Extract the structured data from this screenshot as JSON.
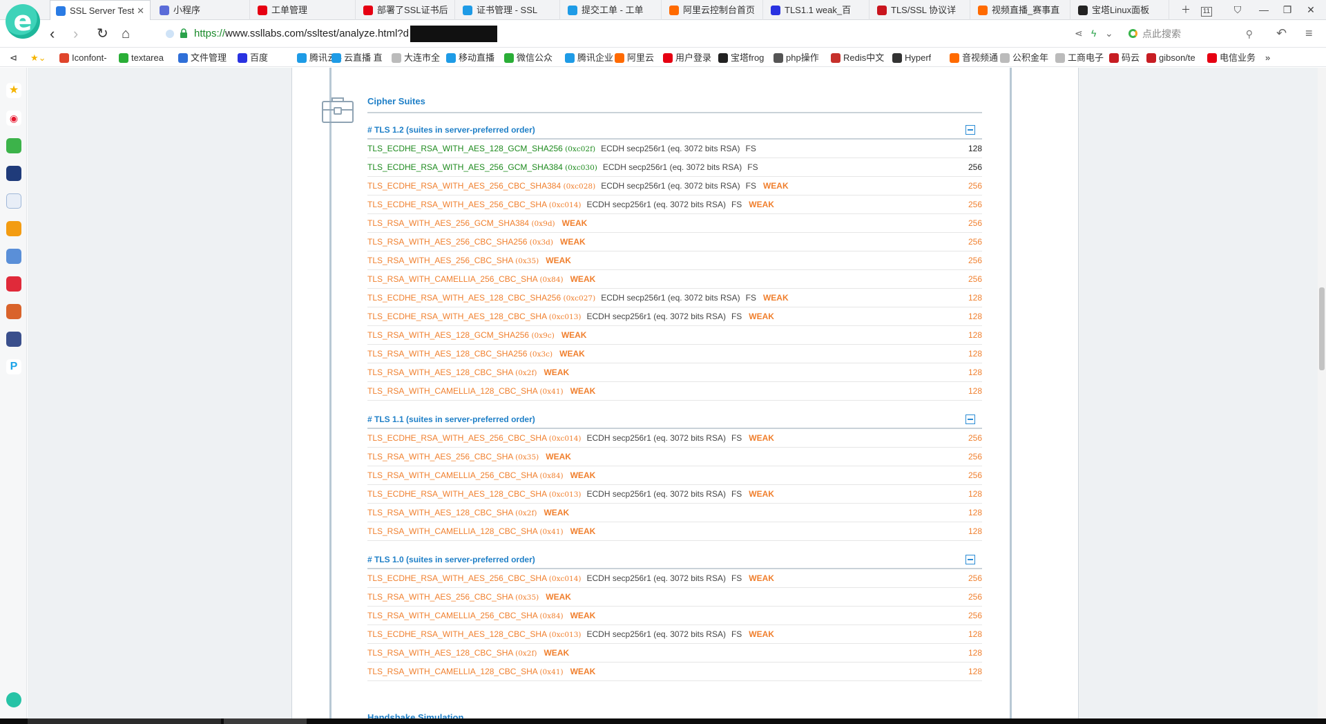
{
  "browser": {
    "tabs": [
      {
        "label": "SSL Server Test",
        "active": true,
        "color": "#2a7be4"
      },
      {
        "label": "小程序",
        "active": false,
        "color": "#5a6bd8"
      },
      {
        "label": "工单管理",
        "active": false,
        "color": "#e60012"
      },
      {
        "label": "部署了SSL证书后",
        "active": false,
        "color": "#e60012"
      },
      {
        "label": "证书管理 - SSL",
        "active": false,
        "color": "#1e9be6"
      },
      {
        "label": "提交工单 - 工单",
        "active": false,
        "color": "#1e9be6"
      },
      {
        "label": "阿里云控制台首页",
        "active": false,
        "color": "#ff6a00"
      },
      {
        "label": "TLS1.1 weak_百",
        "active": false,
        "color": "#2932e1"
      },
      {
        "label": "TLS/SSL 协议详",
        "active": false,
        "color": "#c9151e"
      },
      {
        "label": "视频直播_赛事直",
        "active": false,
        "color": "#ff6a00"
      },
      {
        "label": "宝塔Linux面板",
        "active": false,
        "color": "#222222"
      }
    ],
    "tab_count": "11",
    "url_scheme": "https://",
    "url_host": "www.ssllabs.com",
    "url_path": "/ssltest/analyze.html?d",
    "search_placeholder": "点此搜索",
    "bookmarks": [
      {
        "label": "Iconfont-",
        "color": "#e0452c"
      },
      {
        "label": "textarea",
        "color": "#2aae37"
      },
      {
        "label": "文件管理",
        "color": "#2f6fd8"
      },
      {
        "label": "百度",
        "color": "#2932e1"
      },
      {
        "label": "腾讯云 -",
        "color": "#1e9be6"
      },
      {
        "label": "云直播 直",
        "color": "#1e9be6"
      },
      {
        "label": "大连市全",
        "color": "#bbbbbb"
      },
      {
        "label": "移动直播",
        "color": "#1e9be6"
      },
      {
        "label": "微信公众",
        "color": "#2aae37"
      },
      {
        "label": "腾讯企业",
        "color": "#1e9be6"
      },
      {
        "label": "阿里云",
        "color": "#ff6a00"
      },
      {
        "label": "用户登录",
        "color": "#e60012"
      },
      {
        "label": "宝塔frog",
        "color": "#222222"
      },
      {
        "label": "php操作",
        "color": "#555555"
      },
      {
        "label": "Redis中文",
        "color": "#c6302b"
      },
      {
        "label": "Hyperf",
        "color": "#333333"
      },
      {
        "label": "音视频通",
        "color": "#ff6a00"
      },
      {
        "label": "公积金年",
        "color": "#bbbbbb"
      },
      {
        "label": "工商电子",
        "color": "#bbbbbb"
      },
      {
        "label": "码云",
        "color": "#c71d23"
      },
      {
        "label": "gibson/te",
        "color": "#c71d23"
      },
      {
        "label": "电信业务",
        "color": "#e60012"
      }
    ]
  },
  "section": {
    "title": "Cipher Suites",
    "next_title": "Handshake Simulation"
  },
  "groups": [
    {
      "heading": "# TLS 1.2 (suites in server-preferred order)",
      "rows": [
        {
          "name": "TLS_ECDHE_RSA_WITH_AES_128_GCM_SHA256",
          "hex": "(0xc02f)",
          "info": "ECDH secp256r1 (eq. 3072 bits RSA)",
          "fs": "FS",
          "weak": "",
          "bits": "128",
          "strong": true
        },
        {
          "name": "TLS_ECDHE_RSA_WITH_AES_256_GCM_SHA384",
          "hex": "(0xc030)",
          "info": "ECDH secp256r1 (eq. 3072 bits RSA)",
          "fs": "FS",
          "weak": "",
          "bits": "256",
          "strong": true
        },
        {
          "name": "TLS_ECDHE_RSA_WITH_AES_256_CBC_SHA384",
          "hex": "(0xc028)",
          "info": "ECDH secp256r1 (eq. 3072 bits RSA)",
          "fs": "FS",
          "weak": "WEAK",
          "bits": "256",
          "strong": false
        },
        {
          "name": "TLS_ECDHE_RSA_WITH_AES_256_CBC_SHA",
          "hex": "(0xc014)",
          "info": "ECDH secp256r1 (eq. 3072 bits RSA)",
          "fs": "FS",
          "weak": "WEAK",
          "bits": "256",
          "strong": false
        },
        {
          "name": "TLS_RSA_WITH_AES_256_GCM_SHA384",
          "hex": "(0x9d)",
          "info": "",
          "fs": "",
          "weak": "WEAK",
          "bits": "256",
          "strong": false
        },
        {
          "name": "TLS_RSA_WITH_AES_256_CBC_SHA256",
          "hex": "(0x3d)",
          "info": "",
          "fs": "",
          "weak": "WEAK",
          "bits": "256",
          "strong": false
        },
        {
          "name": "TLS_RSA_WITH_AES_256_CBC_SHA",
          "hex": "(0x35)",
          "info": "",
          "fs": "",
          "weak": "WEAK",
          "bits": "256",
          "strong": false
        },
        {
          "name": "TLS_RSA_WITH_CAMELLIA_256_CBC_SHA",
          "hex": "(0x84)",
          "info": "",
          "fs": "",
          "weak": "WEAK",
          "bits": "256",
          "strong": false
        },
        {
          "name": "TLS_ECDHE_RSA_WITH_AES_128_CBC_SHA256",
          "hex": "(0xc027)",
          "info": "ECDH secp256r1 (eq. 3072 bits RSA)",
          "fs": "FS",
          "weak": "WEAK",
          "bits": "128",
          "strong": false
        },
        {
          "name": "TLS_ECDHE_RSA_WITH_AES_128_CBC_SHA",
          "hex": "(0xc013)",
          "info": "ECDH secp256r1 (eq. 3072 bits RSA)",
          "fs": "FS",
          "weak": "WEAK",
          "bits": "128",
          "strong": false
        },
        {
          "name": "TLS_RSA_WITH_AES_128_GCM_SHA256",
          "hex": "(0x9c)",
          "info": "",
          "fs": "",
          "weak": "WEAK",
          "bits": "128",
          "strong": false
        },
        {
          "name": "TLS_RSA_WITH_AES_128_CBC_SHA256",
          "hex": "(0x3c)",
          "info": "",
          "fs": "",
          "weak": "WEAK",
          "bits": "128",
          "strong": false
        },
        {
          "name": "TLS_RSA_WITH_AES_128_CBC_SHA",
          "hex": "(0x2f)",
          "info": "",
          "fs": "",
          "weak": "WEAK",
          "bits": "128",
          "strong": false
        },
        {
          "name": "TLS_RSA_WITH_CAMELLIA_128_CBC_SHA",
          "hex": "(0x41)",
          "info": "",
          "fs": "",
          "weak": "WEAK",
          "bits": "128",
          "strong": false
        }
      ]
    },
    {
      "heading": "# TLS 1.1 (suites in server-preferred order)",
      "rows": [
        {
          "name": "TLS_ECDHE_RSA_WITH_AES_256_CBC_SHA",
          "hex": "(0xc014)",
          "info": "ECDH secp256r1 (eq. 3072 bits RSA)",
          "fs": "FS",
          "weak": "WEAK",
          "bits": "256",
          "strong": false
        },
        {
          "name": "TLS_RSA_WITH_AES_256_CBC_SHA",
          "hex": "(0x35)",
          "info": "",
          "fs": "",
          "weak": "WEAK",
          "bits": "256",
          "strong": false
        },
        {
          "name": "TLS_RSA_WITH_CAMELLIA_256_CBC_SHA",
          "hex": "(0x84)",
          "info": "",
          "fs": "",
          "weak": "WEAK",
          "bits": "256",
          "strong": false
        },
        {
          "name": "TLS_ECDHE_RSA_WITH_AES_128_CBC_SHA",
          "hex": "(0xc013)",
          "info": "ECDH secp256r1 (eq. 3072 bits RSA)",
          "fs": "FS",
          "weak": "WEAK",
          "bits": "128",
          "strong": false
        },
        {
          "name": "TLS_RSA_WITH_AES_128_CBC_SHA",
          "hex": "(0x2f)",
          "info": "",
          "fs": "",
          "weak": "WEAK",
          "bits": "128",
          "strong": false
        },
        {
          "name": "TLS_RSA_WITH_CAMELLIA_128_CBC_SHA",
          "hex": "(0x41)",
          "info": "",
          "fs": "",
          "weak": "WEAK",
          "bits": "128",
          "strong": false
        }
      ]
    },
    {
      "heading": "# TLS 1.0 (suites in server-preferred order)",
      "rows": [
        {
          "name": "TLS_ECDHE_RSA_WITH_AES_256_CBC_SHA",
          "hex": "(0xc014)",
          "info": "ECDH secp256r1 (eq. 3072 bits RSA)",
          "fs": "FS",
          "weak": "WEAK",
          "bits": "256",
          "strong": false
        },
        {
          "name": "TLS_RSA_WITH_AES_256_CBC_SHA",
          "hex": "(0x35)",
          "info": "",
          "fs": "",
          "weak": "WEAK",
          "bits": "256",
          "strong": false
        },
        {
          "name": "TLS_RSA_WITH_CAMELLIA_256_CBC_SHA",
          "hex": "(0x84)",
          "info": "",
          "fs": "",
          "weak": "WEAK",
          "bits": "256",
          "strong": false
        },
        {
          "name": "TLS_ECDHE_RSA_WITH_AES_128_CBC_SHA",
          "hex": "(0xc013)",
          "info": "ECDH secp256r1 (eq. 3072 bits RSA)",
          "fs": "FS",
          "weak": "WEAK",
          "bits": "128",
          "strong": false
        },
        {
          "name": "TLS_RSA_WITH_AES_128_CBC_SHA",
          "hex": "(0x2f)",
          "info": "",
          "fs": "",
          "weak": "WEAK",
          "bits": "128",
          "strong": false
        },
        {
          "name": "TLS_RSA_WITH_CAMELLIA_128_CBC_SHA",
          "hex": "(0x41)",
          "info": "",
          "fs": "",
          "weak": "WEAK",
          "bits": "128",
          "strong": false
        }
      ]
    }
  ],
  "colors": {
    "accent": "#1e7fc7",
    "weak": "#f07f2d",
    "strong": "#1d8a1d"
  }
}
